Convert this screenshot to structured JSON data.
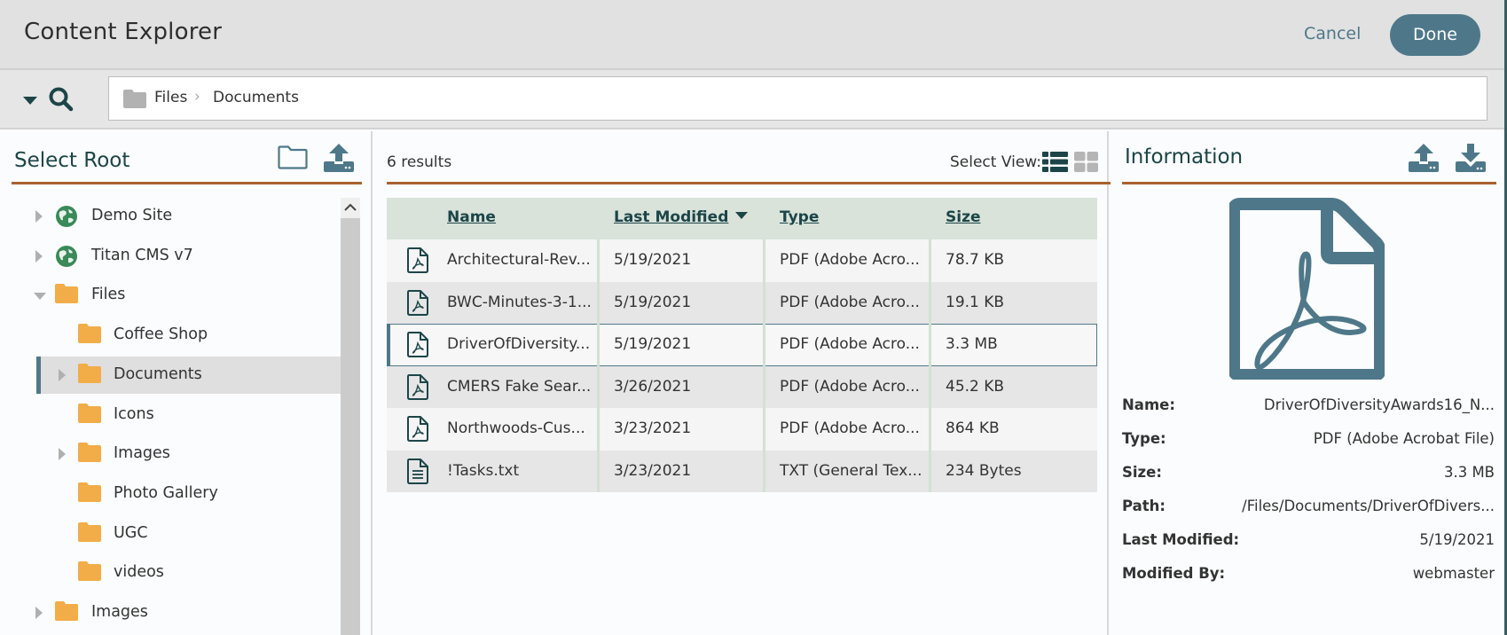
{
  "header": {
    "title": "Content Explorer",
    "cancel_label": "Cancel",
    "done_label": "Done"
  },
  "searchbar": {
    "breadcrumb": [
      {
        "label": "Files",
        "icon": "folder-icon"
      },
      {
        "separator": "›"
      },
      {
        "label": "Documents"
      }
    ]
  },
  "left_panel": {
    "title": "Select Root",
    "actions": [
      "new-folder-icon",
      "upload-icon"
    ],
    "tree": [
      {
        "label": "Demo Site",
        "icon": "globe-icon",
        "level": 0,
        "expander": "collapsed"
      },
      {
        "label": "Titan CMS v7",
        "icon": "globe-icon",
        "level": 0,
        "expander": "collapsed"
      },
      {
        "label": "Files",
        "icon": "folder-icon",
        "level": 0,
        "expander": "expanded"
      },
      {
        "label": "Coffee Shop",
        "icon": "folder-icon",
        "level": 1,
        "expander": "none"
      },
      {
        "label": "Documents",
        "icon": "folder-icon",
        "level": 1,
        "expander": "collapsed",
        "selected": true
      },
      {
        "label": "Icons",
        "icon": "folder-icon",
        "level": 1,
        "expander": "none"
      },
      {
        "label": "Images",
        "icon": "folder-icon",
        "level": 1,
        "expander": "collapsed"
      },
      {
        "label": "Photo Gallery",
        "icon": "folder-icon",
        "level": 1,
        "expander": "none"
      },
      {
        "label": "UGC",
        "icon": "folder-icon",
        "level": 1,
        "expander": "none"
      },
      {
        "label": "videos",
        "icon": "folder-icon",
        "level": 1,
        "expander": "none"
      },
      {
        "label": "Images",
        "icon": "folder-icon",
        "level": 0,
        "expander": "collapsed"
      }
    ]
  },
  "middle_panel": {
    "results_count": "6 results",
    "select_view_label": "Select View:",
    "views": [
      {
        "name": "list-view-icon",
        "active": true
      },
      {
        "name": "grid-view-icon",
        "active": false
      }
    ],
    "columns": [
      "Name",
      "Last Modified",
      "Type",
      "Size"
    ],
    "sorted_column": "Last Modified",
    "sort_direction": "descending",
    "rows": [
      {
        "icon": "pdf-file-icon",
        "name": "Architectural-Rev...",
        "modified": "5/19/2021",
        "type": "PDF (Adobe Acro...",
        "size": "78.7 KB"
      },
      {
        "icon": "pdf-file-icon",
        "name": "BWC-Minutes-3-1...",
        "modified": "5/19/2021",
        "type": "PDF (Adobe Acro...",
        "size": "19.1 KB"
      },
      {
        "icon": "pdf-file-icon",
        "name": "DriverOfDiversity...",
        "modified": "5/19/2021",
        "type": "PDF (Adobe Acro...",
        "size": "3.3 MB",
        "selected": true
      },
      {
        "icon": "pdf-file-icon",
        "name": "CMERS Fake Sear...",
        "modified": "3/26/2021",
        "type": "PDF (Adobe Acro...",
        "size": "45.2 KB"
      },
      {
        "icon": "pdf-file-icon",
        "name": "Northwoods-Cus...",
        "modified": "3/23/2021",
        "type": "PDF (Adobe Acro...",
        "size": "864 KB"
      },
      {
        "icon": "text-file-icon",
        "name": "!Tasks.txt",
        "modified": "3/23/2021",
        "type": "TXT (General Tex...",
        "size": "234 Bytes"
      }
    ]
  },
  "right_panel": {
    "title": "Information",
    "actions": [
      "upload-icon",
      "download-icon"
    ],
    "preview_icon": "pdf-file-icon",
    "fields": [
      {
        "label": "Name:",
        "value": "DriverOfDiversityAwards16_N..."
      },
      {
        "label": "Type:",
        "value": "PDF (Adobe Acrobat File)"
      },
      {
        "label": "Size:",
        "value": "3.3 MB"
      },
      {
        "label": "Path:",
        "value": "/Files/Documents/DriverOfDivers..."
      },
      {
        "label": "Last Modified:",
        "value": "5/19/2021"
      },
      {
        "label": "Modified By:",
        "value": "webmaster"
      }
    ]
  },
  "colors": {
    "accent": "#4e7889",
    "title_dark": "#1c4548",
    "rule": "#a9622f",
    "folder": "#f2ad48",
    "globe": "#3a8a5a",
    "table_header": "#d9e3da"
  }
}
